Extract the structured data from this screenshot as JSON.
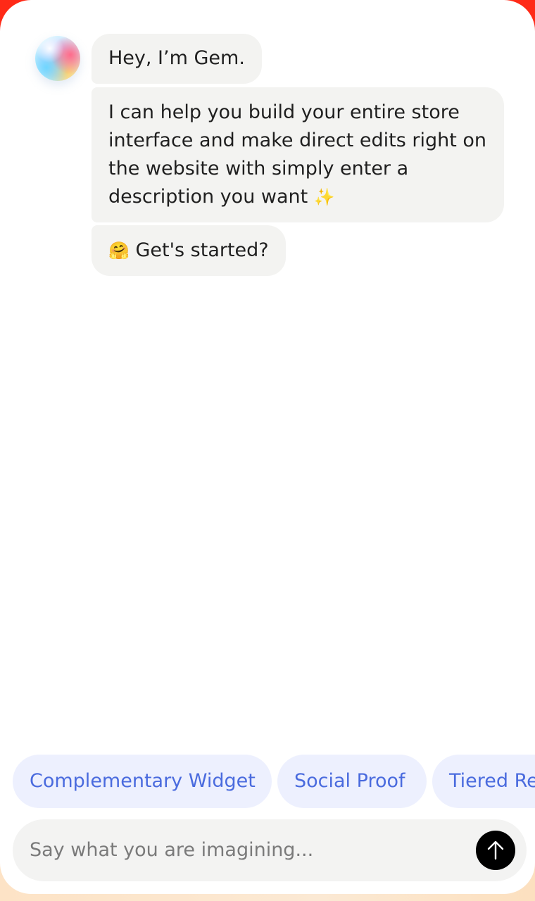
{
  "chat": {
    "messages": [
      {
        "text": "Hey, I’m Gem."
      },
      {
        "text": "I can help you build your entire store interface and make direct edits right on the website with simply enter a description you want",
        "trailing_emoji": "✨"
      },
      {
        "leading_emoji": "🤗",
        "text": "Get's started?"
      }
    ]
  },
  "suggestions": [
    {
      "label": "Complementary Widget"
    },
    {
      "label": "Social Proof"
    },
    {
      "label": "Tiered Re"
    }
  ],
  "composer": {
    "placeholder": "Say what you are imagining...",
    "value": "",
    "send_icon": "arrow-up-icon"
  },
  "colors": {
    "top_background": "#ff2a17",
    "bottom_background": "#fde3c6",
    "bubble": "#f3f3f1",
    "chip_background": "#edf0fe",
    "chip_text": "#4a6bde",
    "send_button": "#000000"
  }
}
